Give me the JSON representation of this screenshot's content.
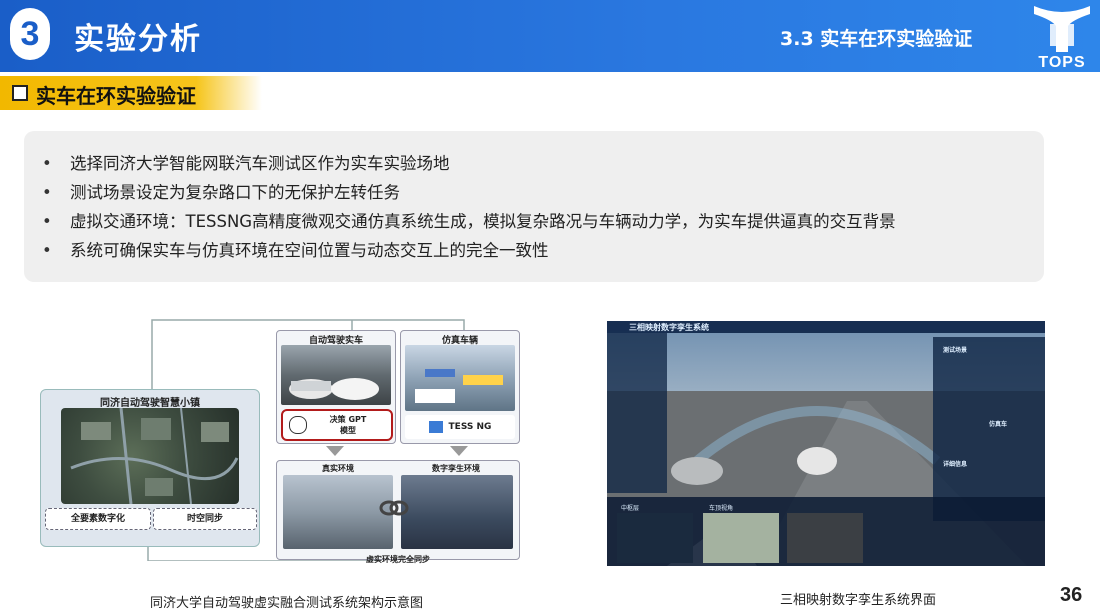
{
  "header": {
    "section_number": "3",
    "section_title": "实验分析",
    "subsection": "3.3   实车在环实验验证",
    "logo_text": "TOPS",
    "colors": {
      "primary": "#1a5ec8",
      "accent": "#f4c000"
    }
  },
  "topic": {
    "label": "实车在环实验验证",
    "icon": "checkbox-icon"
  },
  "bullets": [
    "选择同济大学智能网联汽车测试区作为实车实验场地",
    "测试场景设定为复杂路口下的无保护左转任务",
    "虚拟交通环境：TESSNG高精度微观交通仿真系统生成，模拟复杂路况与车辆动力学，为实车提供逼真的交互背景",
    "系统可确保实车与仿真环境在空间位置与动态交互上的完全一致性"
  ],
  "diagram": {
    "town_title": "同济自动驾驶智慧小镇",
    "town_left_label": "全要素数字化",
    "town_right_label": "时空同步",
    "real_car_title": "自动驾驶实车",
    "gpt_label_1": "决策 GPT",
    "gpt_label_2": "模型",
    "sim_vehicle_title": "仿真车辆",
    "tess_label": "TESS NG",
    "real_env_title": "真实环境",
    "twin_env_title": "数字孪生环境",
    "sync_label": "虚实环境完全同步",
    "caption": "同济大学自动驾驶虚实融合测试系统架构示意图"
  },
  "twin_ui": {
    "title": "三相映射数字孪生系统",
    "bottom_left_label": "中枢层",
    "bottom_mid_label": "车顶视角",
    "right_panel_1": "测试场景",
    "right_panel_2": "仿真车",
    "right_panel_3": "详细信息",
    "caption": "三相映射数字孪生系统界面"
  },
  "page_number": "36"
}
